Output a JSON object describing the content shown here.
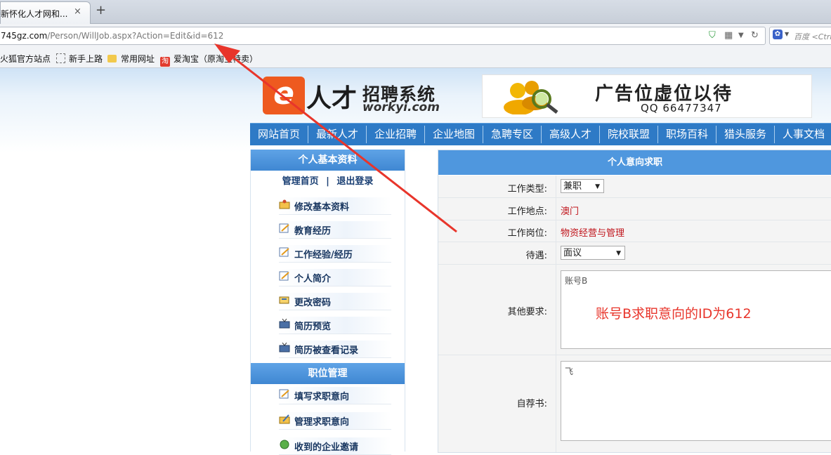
{
  "browser": {
    "tab_title": "新怀化人才网和...",
    "tab_close": "×",
    "new_tab": "+",
    "url_domain": "745gz.com",
    "url_path": "/Person/WillJob.aspx?Action=Edit&id=612",
    "search_placeholder": "百度 <Ctrl",
    "bookmarks": [
      "火狐官方站点",
      "新手上路",
      "常用网址",
      "爱淘宝（原淘宝特卖）"
    ]
  },
  "header": {
    "logo_ren": "人才",
    "logo_title": "招聘系统",
    "logo_domain": "workyi.com",
    "ad_main": "广告位虚位以待",
    "ad_qq": "QQ  66477347"
  },
  "nav": [
    "网站首页",
    "最新人才",
    "企业招聘",
    "企业地图",
    "急聘专区",
    "高级人才",
    "院校联盟",
    "职场百科",
    "猎头服务",
    "人事文档"
  ],
  "sidebar": {
    "section1": "个人基本资料",
    "links": {
      "home": "管理首页",
      "sep": "|",
      "logout": "退出登录"
    },
    "items": [
      "修改基本资料",
      "教育经历",
      "工作经验/经历",
      "个人简介",
      "更改密码",
      "简历预览",
      "简历被查看记录"
    ],
    "section2": "职位管理",
    "items2": [
      "填写求职意向",
      "管理求职意向",
      "收到的企业邀请"
    ]
  },
  "form": {
    "title": "个人意向求职",
    "work_type_label": "工作类型:",
    "work_type_value": "兼职",
    "location_label": "工作地点:",
    "location_value": "澳门",
    "position_label": "工作岗位:",
    "position_value": "物资经营与管理",
    "salary_label": "待遇:",
    "salary_value": "面议",
    "other_label": "其他要求:",
    "other_value": "账号B",
    "intro_label": "自荐书:",
    "intro_value": "飞"
  },
  "annotation": "账号B求职意向的ID为612",
  "colors": {
    "nav_bg": "#2e7ac6",
    "accent_red": "#e8352b",
    "value_red": "#c0131a"
  }
}
